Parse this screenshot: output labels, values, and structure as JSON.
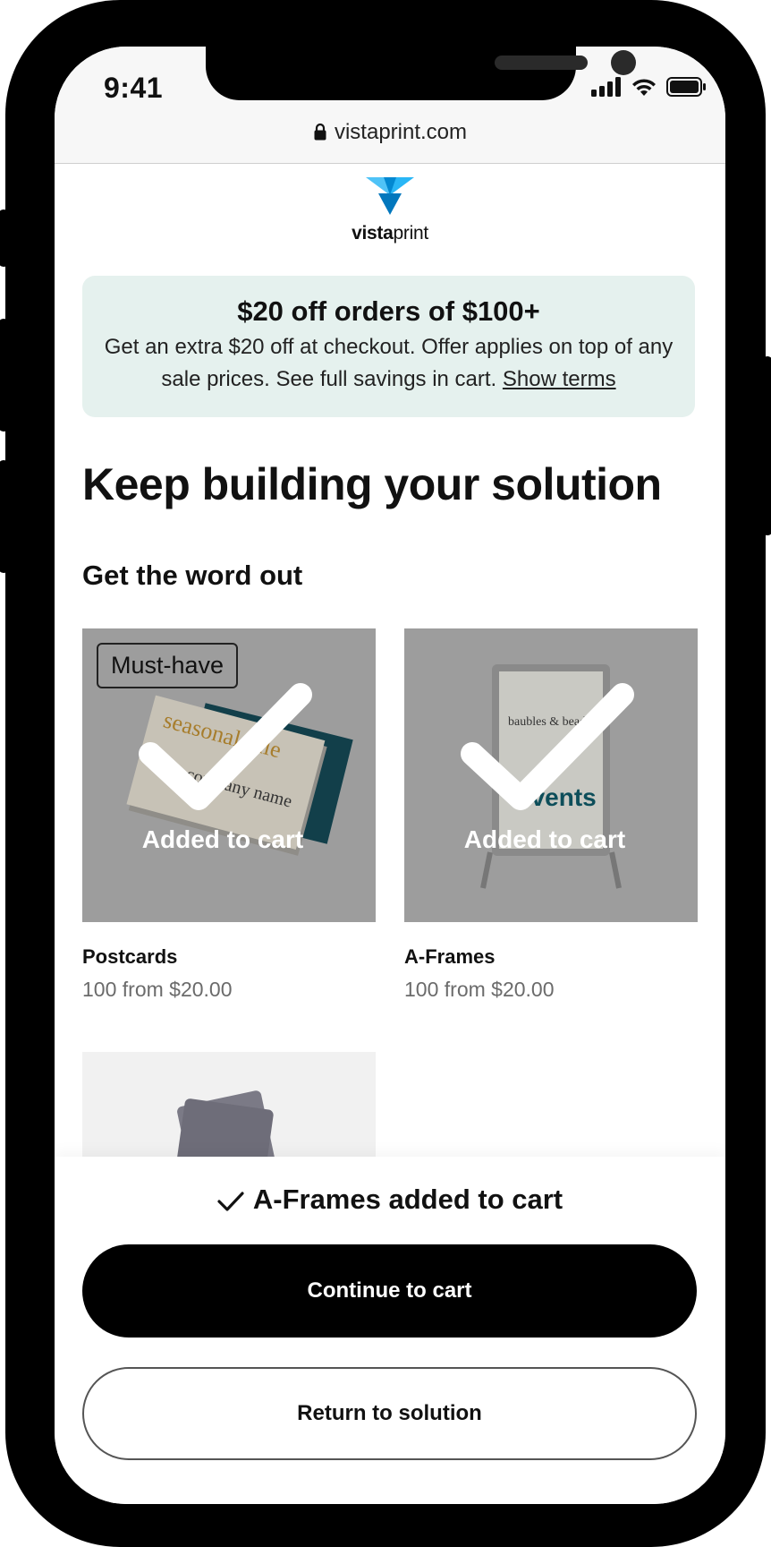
{
  "status_bar": {
    "time": "9:41",
    "url": "vistaprint.com"
  },
  "brand": {
    "name_bold": "vista",
    "name_light": "print",
    "colors": {
      "logo_light": "#4fc3f7",
      "logo_dark": "#0277bd"
    }
  },
  "promo": {
    "title": "$20 off orders of $100+",
    "body": "Get an extra $20 off at checkout. Offer applies on top of any sale prices. See full savings in cart.",
    "link": "Show terms",
    "background": "#e5f1ee"
  },
  "page_title": "Keep building your solution",
  "section_title": "Get the word out",
  "products": [
    {
      "name": "Postcards",
      "price": "100 from $20.00",
      "badge": "Must-have",
      "overlay": "Added to cart",
      "icon": "check-icon"
    },
    {
      "name": "A-Frames",
      "price": "100 from $20.00",
      "overlay": "Added to cart",
      "icon": "check-icon"
    }
  ],
  "confirmation": {
    "message": "A-Frames added to cart",
    "primary_button": "Continue to cart",
    "secondary_button": "Return to solution"
  }
}
